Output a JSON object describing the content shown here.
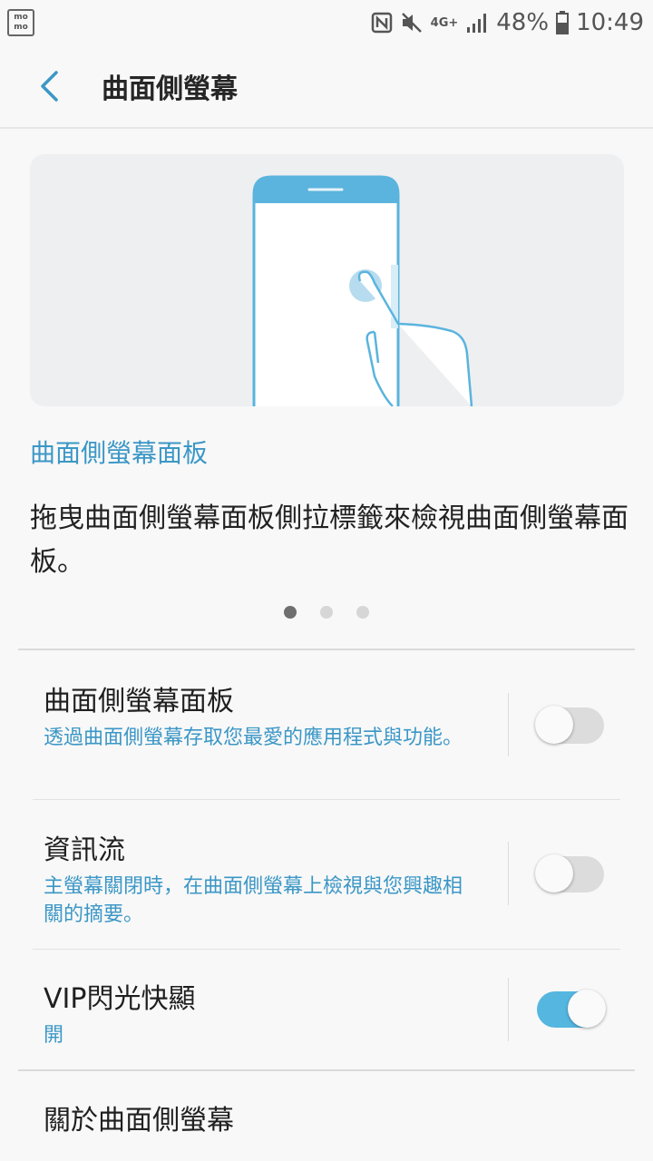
{
  "status_bar": {
    "app_icon_text": "mo mo",
    "network": "4G+",
    "battery_percent": "48%",
    "time": "10:49"
  },
  "header": {
    "title": "曲面側螢幕"
  },
  "intro": {
    "section_title": "曲面側螢幕面板",
    "description": "拖曳曲面側螢幕面板側拉標籤來檢視曲面側螢幕面板。",
    "page_count": 3,
    "active_page": 1
  },
  "settings": [
    {
      "title": "曲面側螢幕面板",
      "subtitle": "透過曲面側螢幕存取您最愛的應用程式與功能。",
      "enabled": false
    },
    {
      "title": "資訊流",
      "subtitle": "主螢幕關閉時，在曲面側螢幕上檢視與您興趣相關的摘要。",
      "enabled": false
    },
    {
      "title": "VIP閃光快顯",
      "subtitle": "開",
      "enabled": true
    }
  ],
  "about": {
    "label": "關於曲面側螢幕"
  },
  "colors": {
    "accent": "#3b97c6",
    "toggle_on": "#55b6e0",
    "phone_top": "#5ab4de"
  }
}
